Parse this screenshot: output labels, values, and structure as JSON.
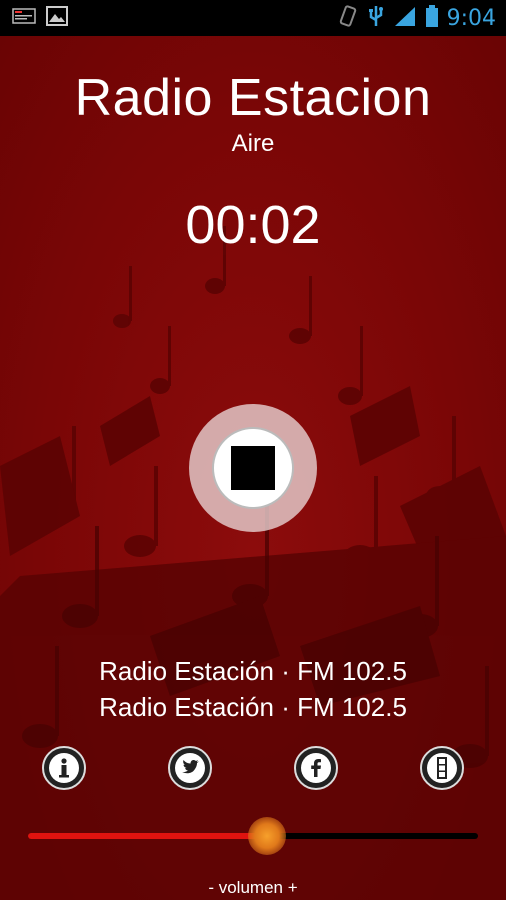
{
  "status_bar": {
    "time": "9:04",
    "icons": [
      "notification-icon",
      "gallery-icon",
      "rotate-icon",
      "usb-icon",
      "signal-icon",
      "battery-icon"
    ]
  },
  "player": {
    "title": "Radio Estacion",
    "subtitle": "Aire",
    "elapsed": "00:02",
    "stop_icon": "stop-icon"
  },
  "station_lines": [
    "Radio Estación · FM 102.5",
    "Radio Estación · FM 102.5"
  ],
  "social": [
    {
      "icon": "info-icon"
    },
    {
      "icon": "twitter-icon"
    },
    {
      "icon": "facebook-icon"
    },
    {
      "icon": "stop-menu-icon"
    }
  ],
  "volume": {
    "label": "- volumen +",
    "level": 0.53
  },
  "colors": {
    "background": "#7d0707",
    "volume_fill": "#e0130f",
    "knob": "#f08a22",
    "clock": "#3aa5e0"
  }
}
